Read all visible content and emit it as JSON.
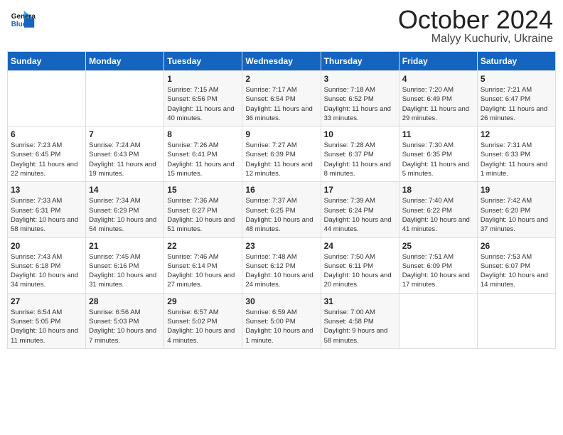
{
  "logo": {
    "line1": "General",
    "line2": "Blue"
  },
  "title": "October 2024",
  "subtitle": "Malyy Kuchuriv, Ukraine",
  "weekdays": [
    "Sunday",
    "Monday",
    "Tuesday",
    "Wednesday",
    "Thursday",
    "Friday",
    "Saturday"
  ],
  "weeks": [
    [
      {
        "day": "",
        "info": ""
      },
      {
        "day": "",
        "info": ""
      },
      {
        "day": "1",
        "info": "Sunrise: 7:15 AM\nSunset: 6:56 PM\nDaylight: 11 hours and 40 minutes."
      },
      {
        "day": "2",
        "info": "Sunrise: 7:17 AM\nSunset: 6:54 PM\nDaylight: 11 hours and 36 minutes."
      },
      {
        "day": "3",
        "info": "Sunrise: 7:18 AM\nSunset: 6:52 PM\nDaylight: 11 hours and 33 minutes."
      },
      {
        "day": "4",
        "info": "Sunrise: 7:20 AM\nSunset: 6:49 PM\nDaylight: 11 hours and 29 minutes."
      },
      {
        "day": "5",
        "info": "Sunrise: 7:21 AM\nSunset: 6:47 PM\nDaylight: 11 hours and 26 minutes."
      }
    ],
    [
      {
        "day": "6",
        "info": "Sunrise: 7:23 AM\nSunset: 6:45 PM\nDaylight: 11 hours and 22 minutes."
      },
      {
        "day": "7",
        "info": "Sunrise: 7:24 AM\nSunset: 6:43 PM\nDaylight: 11 hours and 19 minutes."
      },
      {
        "day": "8",
        "info": "Sunrise: 7:26 AM\nSunset: 6:41 PM\nDaylight: 11 hours and 15 minutes."
      },
      {
        "day": "9",
        "info": "Sunrise: 7:27 AM\nSunset: 6:39 PM\nDaylight: 11 hours and 12 minutes."
      },
      {
        "day": "10",
        "info": "Sunrise: 7:28 AM\nSunset: 6:37 PM\nDaylight: 11 hours and 8 minutes."
      },
      {
        "day": "11",
        "info": "Sunrise: 7:30 AM\nSunset: 6:35 PM\nDaylight: 11 hours and 5 minutes."
      },
      {
        "day": "12",
        "info": "Sunrise: 7:31 AM\nSunset: 6:33 PM\nDaylight: 11 hours and 1 minute."
      }
    ],
    [
      {
        "day": "13",
        "info": "Sunrise: 7:33 AM\nSunset: 6:31 PM\nDaylight: 10 hours and 58 minutes."
      },
      {
        "day": "14",
        "info": "Sunrise: 7:34 AM\nSunset: 6:29 PM\nDaylight: 10 hours and 54 minutes."
      },
      {
        "day": "15",
        "info": "Sunrise: 7:36 AM\nSunset: 6:27 PM\nDaylight: 10 hours and 51 minutes."
      },
      {
        "day": "16",
        "info": "Sunrise: 7:37 AM\nSunset: 6:25 PM\nDaylight: 10 hours and 48 minutes."
      },
      {
        "day": "17",
        "info": "Sunrise: 7:39 AM\nSunset: 6:24 PM\nDaylight: 10 hours and 44 minutes."
      },
      {
        "day": "18",
        "info": "Sunrise: 7:40 AM\nSunset: 6:22 PM\nDaylight: 10 hours and 41 minutes."
      },
      {
        "day": "19",
        "info": "Sunrise: 7:42 AM\nSunset: 6:20 PM\nDaylight: 10 hours and 37 minutes."
      }
    ],
    [
      {
        "day": "20",
        "info": "Sunrise: 7:43 AM\nSunset: 6:18 PM\nDaylight: 10 hours and 34 minutes."
      },
      {
        "day": "21",
        "info": "Sunrise: 7:45 AM\nSunset: 6:16 PM\nDaylight: 10 hours and 31 minutes."
      },
      {
        "day": "22",
        "info": "Sunrise: 7:46 AM\nSunset: 6:14 PM\nDaylight: 10 hours and 27 minutes."
      },
      {
        "day": "23",
        "info": "Sunrise: 7:48 AM\nSunset: 6:12 PM\nDaylight: 10 hours and 24 minutes."
      },
      {
        "day": "24",
        "info": "Sunrise: 7:50 AM\nSunset: 6:11 PM\nDaylight: 10 hours and 20 minutes."
      },
      {
        "day": "25",
        "info": "Sunrise: 7:51 AM\nSunset: 6:09 PM\nDaylight: 10 hours and 17 minutes."
      },
      {
        "day": "26",
        "info": "Sunrise: 7:53 AM\nSunset: 6:07 PM\nDaylight: 10 hours and 14 minutes."
      }
    ],
    [
      {
        "day": "27",
        "info": "Sunrise: 6:54 AM\nSunset: 5:05 PM\nDaylight: 10 hours and 11 minutes."
      },
      {
        "day": "28",
        "info": "Sunrise: 6:56 AM\nSunset: 5:03 PM\nDaylight: 10 hours and 7 minutes."
      },
      {
        "day": "29",
        "info": "Sunrise: 6:57 AM\nSunset: 5:02 PM\nDaylight: 10 hours and 4 minutes."
      },
      {
        "day": "30",
        "info": "Sunrise: 6:59 AM\nSunset: 5:00 PM\nDaylight: 10 hours and 1 minute."
      },
      {
        "day": "31",
        "info": "Sunrise: 7:00 AM\nSunset: 4:58 PM\nDaylight: 9 hours and 58 minutes."
      },
      {
        "day": "",
        "info": ""
      },
      {
        "day": "",
        "info": ""
      }
    ]
  ]
}
